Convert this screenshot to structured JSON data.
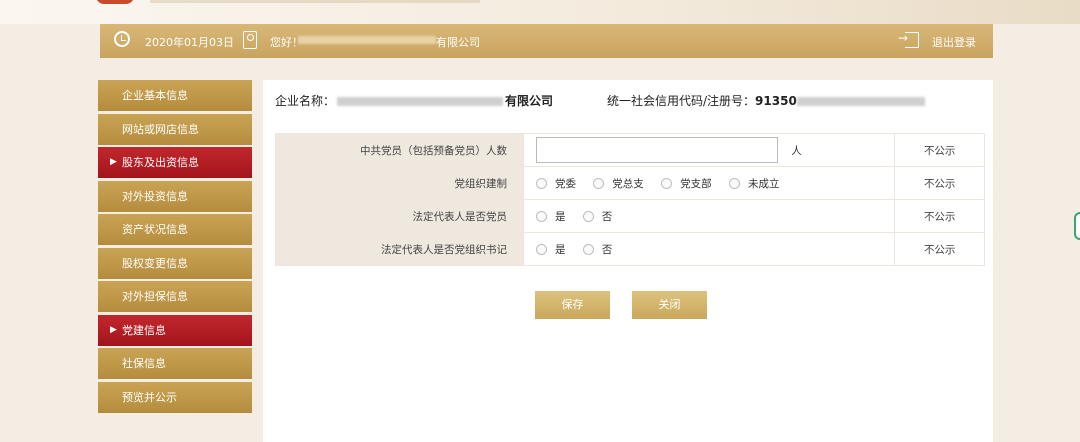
{
  "header": {
    "date": "2020年01月03日",
    "greeting": "您好！",
    "company_suffix": "有限公司",
    "logout": "退出登录"
  },
  "sidebar": {
    "items": [
      {
        "label": "企业基本信息",
        "active": false
      },
      {
        "label": "网站或网店信息",
        "active": false
      },
      {
        "label": "股东及出资信息",
        "active": true
      },
      {
        "label": "对外投资信息",
        "active": false
      },
      {
        "label": "资产状况信息",
        "active": false
      },
      {
        "label": "股权变更信息",
        "active": false
      },
      {
        "label": "对外担保信息",
        "active": false
      },
      {
        "label": "党建信息",
        "active": true
      },
      {
        "label": "社保信息",
        "active": false
      },
      {
        "label": "预览并公示",
        "active": false
      }
    ],
    "arrow": "▶"
  },
  "company": {
    "name_label": "企业名称：",
    "name_suffix": "有限公司",
    "credit_label": "统一社会信用代码/注册号：",
    "credit_prefix": "91350"
  },
  "form": {
    "rows": [
      {
        "label": "中共党员（包括预备党员）人数",
        "input_value": "",
        "unit": "人",
        "public": "不公示"
      },
      {
        "label": "党组织建制",
        "options": [
          "党委",
          "党总支",
          "党支部",
          "未成立"
        ],
        "public": "不公示"
      },
      {
        "label": "法定代表人是否党员",
        "options": [
          "是",
          "否"
        ],
        "public": "不公示"
      },
      {
        "label": "法定代表人是否党组织书记",
        "options": [
          "是",
          "否"
        ],
        "public": "不公示"
      }
    ]
  },
  "buttons": {
    "save": "保存",
    "close": "关闭"
  },
  "colors": {
    "gold": "#c9a454",
    "active_red": "#b81e24",
    "label_bg": "#efe8df"
  }
}
